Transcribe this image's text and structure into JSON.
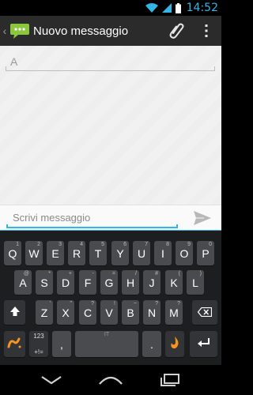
{
  "status_bar": {
    "time": "14:52",
    "accent_color": "#33b5e5"
  },
  "action_bar": {
    "title": "Nuovo messaggio",
    "icons": [
      "messaging-app-icon",
      "attach-icon",
      "overflow-menu-icon"
    ]
  },
  "recipient": {
    "placeholder": "A"
  },
  "compose": {
    "placeholder": "Scrivi messaggio",
    "send_icon": "send-icon"
  },
  "keyboard": {
    "row1": [
      {
        "label": "Q",
        "hint": "1"
      },
      {
        "label": "W",
        "hint": "2"
      },
      {
        "label": "E",
        "hint": "3"
      },
      {
        "label": "R",
        "hint": "4"
      },
      {
        "label": "T",
        "hint": "5"
      },
      {
        "label": "Y",
        "hint": "6"
      },
      {
        "label": "U",
        "hint": "7"
      },
      {
        "label": "I",
        "hint": "8"
      },
      {
        "label": "O",
        "hint": "9"
      },
      {
        "label": "P",
        "hint": "0"
      }
    ],
    "row2": [
      {
        "label": "A",
        "hint": "@"
      },
      {
        "label": "S",
        "hint": "*"
      },
      {
        "label": "D",
        "hint": "+"
      },
      {
        "label": "F",
        "hint": "-"
      },
      {
        "label": "G",
        "hint": "="
      },
      {
        "label": "H",
        "hint": "/"
      },
      {
        "label": "J",
        "hint": "#"
      },
      {
        "label": "K",
        "hint": "("
      },
      {
        "label": "L",
        "hint": ")"
      }
    ],
    "row3": [
      {
        "label": "Z",
        "hint": "'"
      },
      {
        "label": "X",
        "hint": "\""
      },
      {
        "label": "C",
        "hint": "?"
      },
      {
        "label": "V",
        "hint": "!"
      },
      {
        "label": "B",
        "hint": "~"
      },
      {
        "label": "N",
        "hint": "?"
      },
      {
        "label": "M",
        "hint": "?"
      }
    ],
    "symbols_key": {
      "top": "123",
      "bottom": "+!="
    },
    "comma": ",",
    "space_language": "IT",
    "period": ".",
    "shift_icon": "shift-arrow-icon",
    "backspace_icon": "backspace-icon",
    "swype_icon": "swype-logo-icon",
    "voice_icon": "dragon-voice-icon",
    "enter_icon": "enter-icon"
  },
  "nav_bar": {
    "icons": [
      "back-icon",
      "home-icon",
      "recent-apps-icon"
    ]
  }
}
